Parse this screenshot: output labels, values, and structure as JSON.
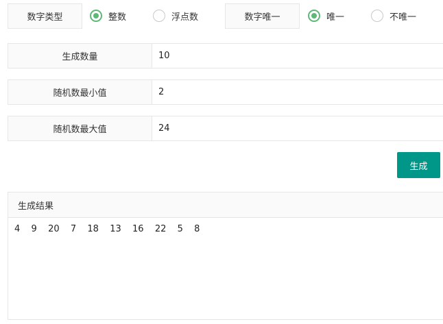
{
  "number_type": {
    "label": "数字类型",
    "options": [
      {
        "label": "整数",
        "checked": true
      },
      {
        "label": "浮点数",
        "checked": false
      }
    ]
  },
  "number_unique": {
    "label": "数字唯一",
    "options": [
      {
        "label": "唯一",
        "checked": true
      },
      {
        "label": "不唯一",
        "checked": false
      }
    ]
  },
  "form": {
    "count": {
      "label": "生成数量",
      "value": "10"
    },
    "min": {
      "label": "随机数最小值",
      "value": "2"
    },
    "max": {
      "label": "随机数最大值",
      "value": "24"
    }
  },
  "generate_button": {
    "label": "生成"
  },
  "result": {
    "title": "生成结果",
    "text": "4  9  20  7  18  13  16  22  5  8"
  },
  "colors": {
    "accent": "#009688",
    "radio_checked": "#5fb878",
    "border": "#e6e6e6",
    "label_bg": "#fafafa"
  }
}
